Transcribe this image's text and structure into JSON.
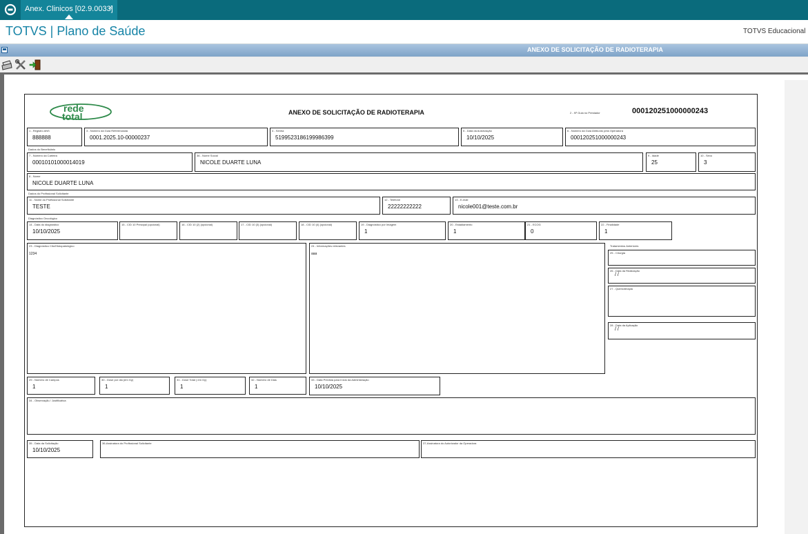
{
  "tab": {
    "label": "Anex. Clinicos [02.9.0033]",
    "close": "×"
  },
  "header": {
    "app_title": "TOTVS | Plano de Saúde",
    "org": "TOTVS Educacional M"
  },
  "window": {
    "title": "ANEXO DE SOLICITAÇÃO DE RADIOTERAPIA"
  },
  "toolbar": {
    "icons": [
      "printer-icon",
      "tools-icon",
      "exit-icon"
    ]
  },
  "form": {
    "logo_text": [
      "rede",
      "total"
    ],
    "title": "ANEXO DE SOLICITAÇÃO DE RADIOTERAPIA",
    "guia_prestador_label": "2 - Nº Guia no Prestador",
    "guia_prestador": "000120251000000243",
    "registro_ans": {
      "label": "1 - Registro ANS",
      "value": "888888"
    },
    "guia_referenciada": {
      "label": "3 - Número da Guia Referenciada",
      "value": "0001.2025.10-00000237"
    },
    "senha": {
      "label": "4 - Senha",
      "value": "5199523186199986399"
    },
    "data_autorizacao": {
      "label": "5 - Data da Autorização",
      "value": "10/10/2025"
    },
    "guia_operadora": {
      "label": "6 - Número da Guia Atribuído pela Operadora",
      "value": "000120251000000243"
    },
    "sec_beneficiario": "Dados do Beneficiário",
    "carteira": {
      "label": "7 - Número da Carteira",
      "value": "00010101000014019"
    },
    "nome_social": {
      "label": "36 - Nome Social",
      "value": "NICOLE DUARTE LUNA"
    },
    "idade": {
      "label": "9 - Idade",
      "value": "25"
    },
    "sexo": {
      "label": "10 - Sexo",
      "value": "3"
    },
    "nome": {
      "label": "8 - Nome",
      "value": "NICOLE DUARTE LUNA"
    },
    "sec_profissional": "Dados do Profissional Solicitante",
    "profissional": {
      "label": "11 - Nome do Profissional Solicitante",
      "value": "TESTE"
    },
    "telefone": {
      "label": "12 - Telefone",
      "value": "22222222222"
    },
    "email": {
      "label": "13 - E-mail",
      "value": "nicole001@teste.com.br"
    },
    "sec_diagnostico": "Diagnóstico Oncológico",
    "data_diagnostico": {
      "label": "14 - Data do diagnóstico",
      "value": "10/10/2025"
    },
    "cid_principal": {
      "label": "15 - CID 10 Principal (opcional)",
      "value": ""
    },
    "cid_2": {
      "label": "16 - CID 10 (2) (opcional)",
      "value": ""
    },
    "cid_3": {
      "label": "17 - CID 10 (3) (opcional)",
      "value": ""
    },
    "cid_4": {
      "label": "18 - CID 10 (4) (opcional)",
      "value": ""
    },
    "diag_imagem": {
      "label": "19 - Diagnóstico por Imagem",
      "value": "1"
    },
    "estadiamento": {
      "label": "20 - Estadiamento",
      "value": "1"
    },
    "ecog": {
      "label": "21 - ECOG",
      "value": "0"
    },
    "finalidade": {
      "label": "22 - Finalidade",
      "value": "1"
    },
    "diag_cito": {
      "label": "23 - Diagnóstico Cito/Histopatológico",
      "value": "1234"
    },
    "info_relevantes": {
      "label": "24 - Informações relevantes",
      "value": "aaa"
    },
    "tratamentos_anteriores": "Tratamentos Anteriores",
    "cirurgia": {
      "label": "25 - Cirurgia",
      "value": ""
    },
    "data_realizacao": {
      "label": "26 - Data da Realização",
      "value": "/ /"
    },
    "quimioterapia": {
      "label": "27 - Quimioterapia",
      "value": ""
    },
    "data_aplicacao": {
      "label": "28 - Data da Aplicação",
      "value": "/ /"
    },
    "num_campos": {
      "label": "29 - Número de Campos",
      "value": "1"
    },
    "dose_dia": {
      "label": "30 - Dose por dia (em Gy)",
      "value": "1"
    },
    "dose_total": {
      "label": "31 - Dose Total ( em Gy)",
      "value": "1"
    },
    "num_dias": {
      "label": "32 - Número de Dias",
      "value": "1"
    },
    "data_prevista": {
      "label": "33 - Data Prevista para Início da Administração",
      "value": "10/10/2025"
    },
    "observacao": {
      "label": "34 - Observação / Justificativa",
      "value": ""
    },
    "data_solicitacao": {
      "label": "35 - Data da Solicitação",
      "value": "10/10/2025"
    },
    "assinatura_prof": {
      "label": "36-Assinatura do Profissional Solicitante",
      "value": ""
    },
    "assinatura_op": {
      "label": "37-Assinatura do Autorizador da Operadora",
      "value": ""
    }
  }
}
